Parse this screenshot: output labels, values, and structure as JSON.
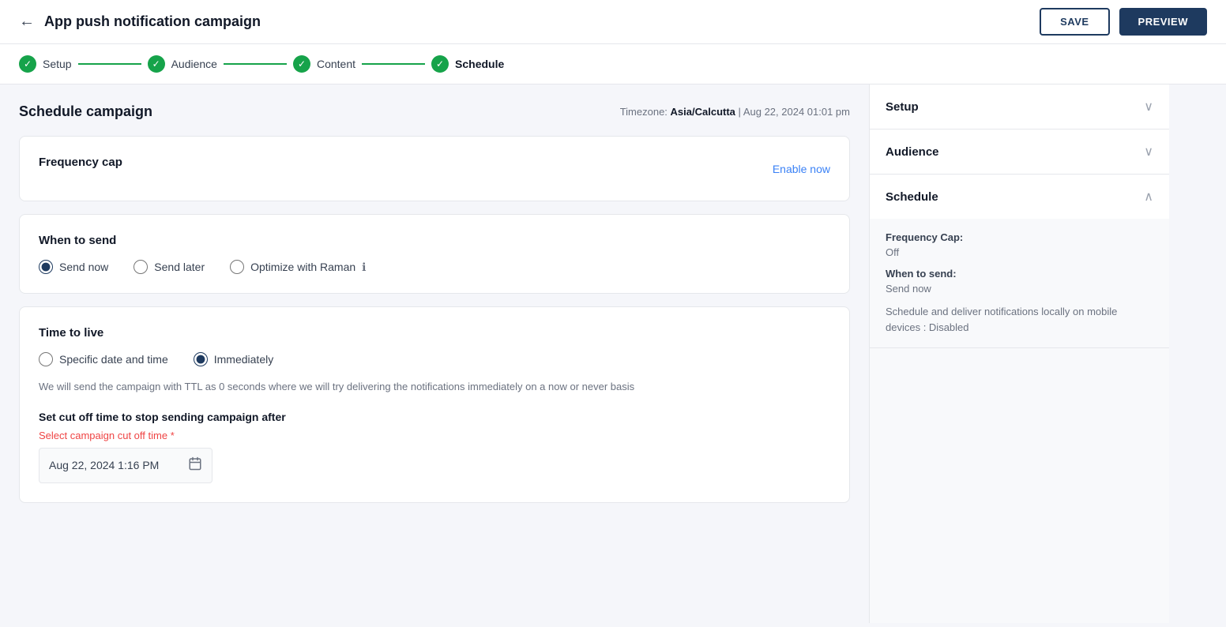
{
  "topbar": {
    "back_icon": "←",
    "title": "App push notification campaign",
    "save_label": "SAVE",
    "preview_label": "PREVIEW"
  },
  "steps": [
    {
      "id": "setup",
      "label": "Setup",
      "completed": true,
      "active": false
    },
    {
      "id": "audience",
      "label": "Audience",
      "completed": true,
      "active": false
    },
    {
      "id": "content",
      "label": "Content",
      "completed": true,
      "active": false
    },
    {
      "id": "schedule",
      "label": "Schedule",
      "completed": true,
      "active": true
    }
  ],
  "main": {
    "section_title": "Schedule campaign",
    "timezone_label": "Timezone:",
    "timezone_value": "Asia/Calcutta",
    "timezone_datetime": "Aug 22, 2024 01:01 pm",
    "frequency_cap": {
      "label": "Frequency cap",
      "enable_now": "Enable now"
    },
    "when_to_send": {
      "label": "When to send",
      "options": [
        {
          "id": "send_now",
          "label": "Send now",
          "selected": true
        },
        {
          "id": "send_later",
          "label": "Send later",
          "selected": false
        },
        {
          "id": "optimize",
          "label": "Optimize with Raman",
          "selected": false
        }
      ]
    },
    "time_to_live": {
      "label": "Time to live",
      "options": [
        {
          "id": "specific_date",
          "label": "Specific date and time",
          "selected": false
        },
        {
          "id": "immediately",
          "label": "Immediately",
          "selected": true
        }
      ],
      "description": "We will send the campaign with TTL as 0 seconds where we will try delivering the notifications immediately on a now or never basis"
    },
    "cutoff": {
      "title": "Set cut off time to stop sending campaign after",
      "label": "Select campaign cut off time",
      "required": "*",
      "value": "Aug 22, 2024 1:16 PM",
      "calendar_icon": "📅"
    }
  },
  "sidebar": {
    "sections": [
      {
        "id": "setup",
        "label": "Setup",
        "expanded": false,
        "chevron": "∨"
      },
      {
        "id": "audience",
        "label": "Audience",
        "expanded": false,
        "chevron": "∨"
      },
      {
        "id": "schedule",
        "label": "Schedule",
        "expanded": true,
        "chevron": "∧",
        "details": [
          {
            "label": "Frequency Cap:",
            "value": "Off"
          },
          {
            "label": "When to send:",
            "value": "Send now"
          }
        ],
        "note": "Schedule and deliver notifications locally on mobile devices : Disabled"
      }
    ]
  }
}
